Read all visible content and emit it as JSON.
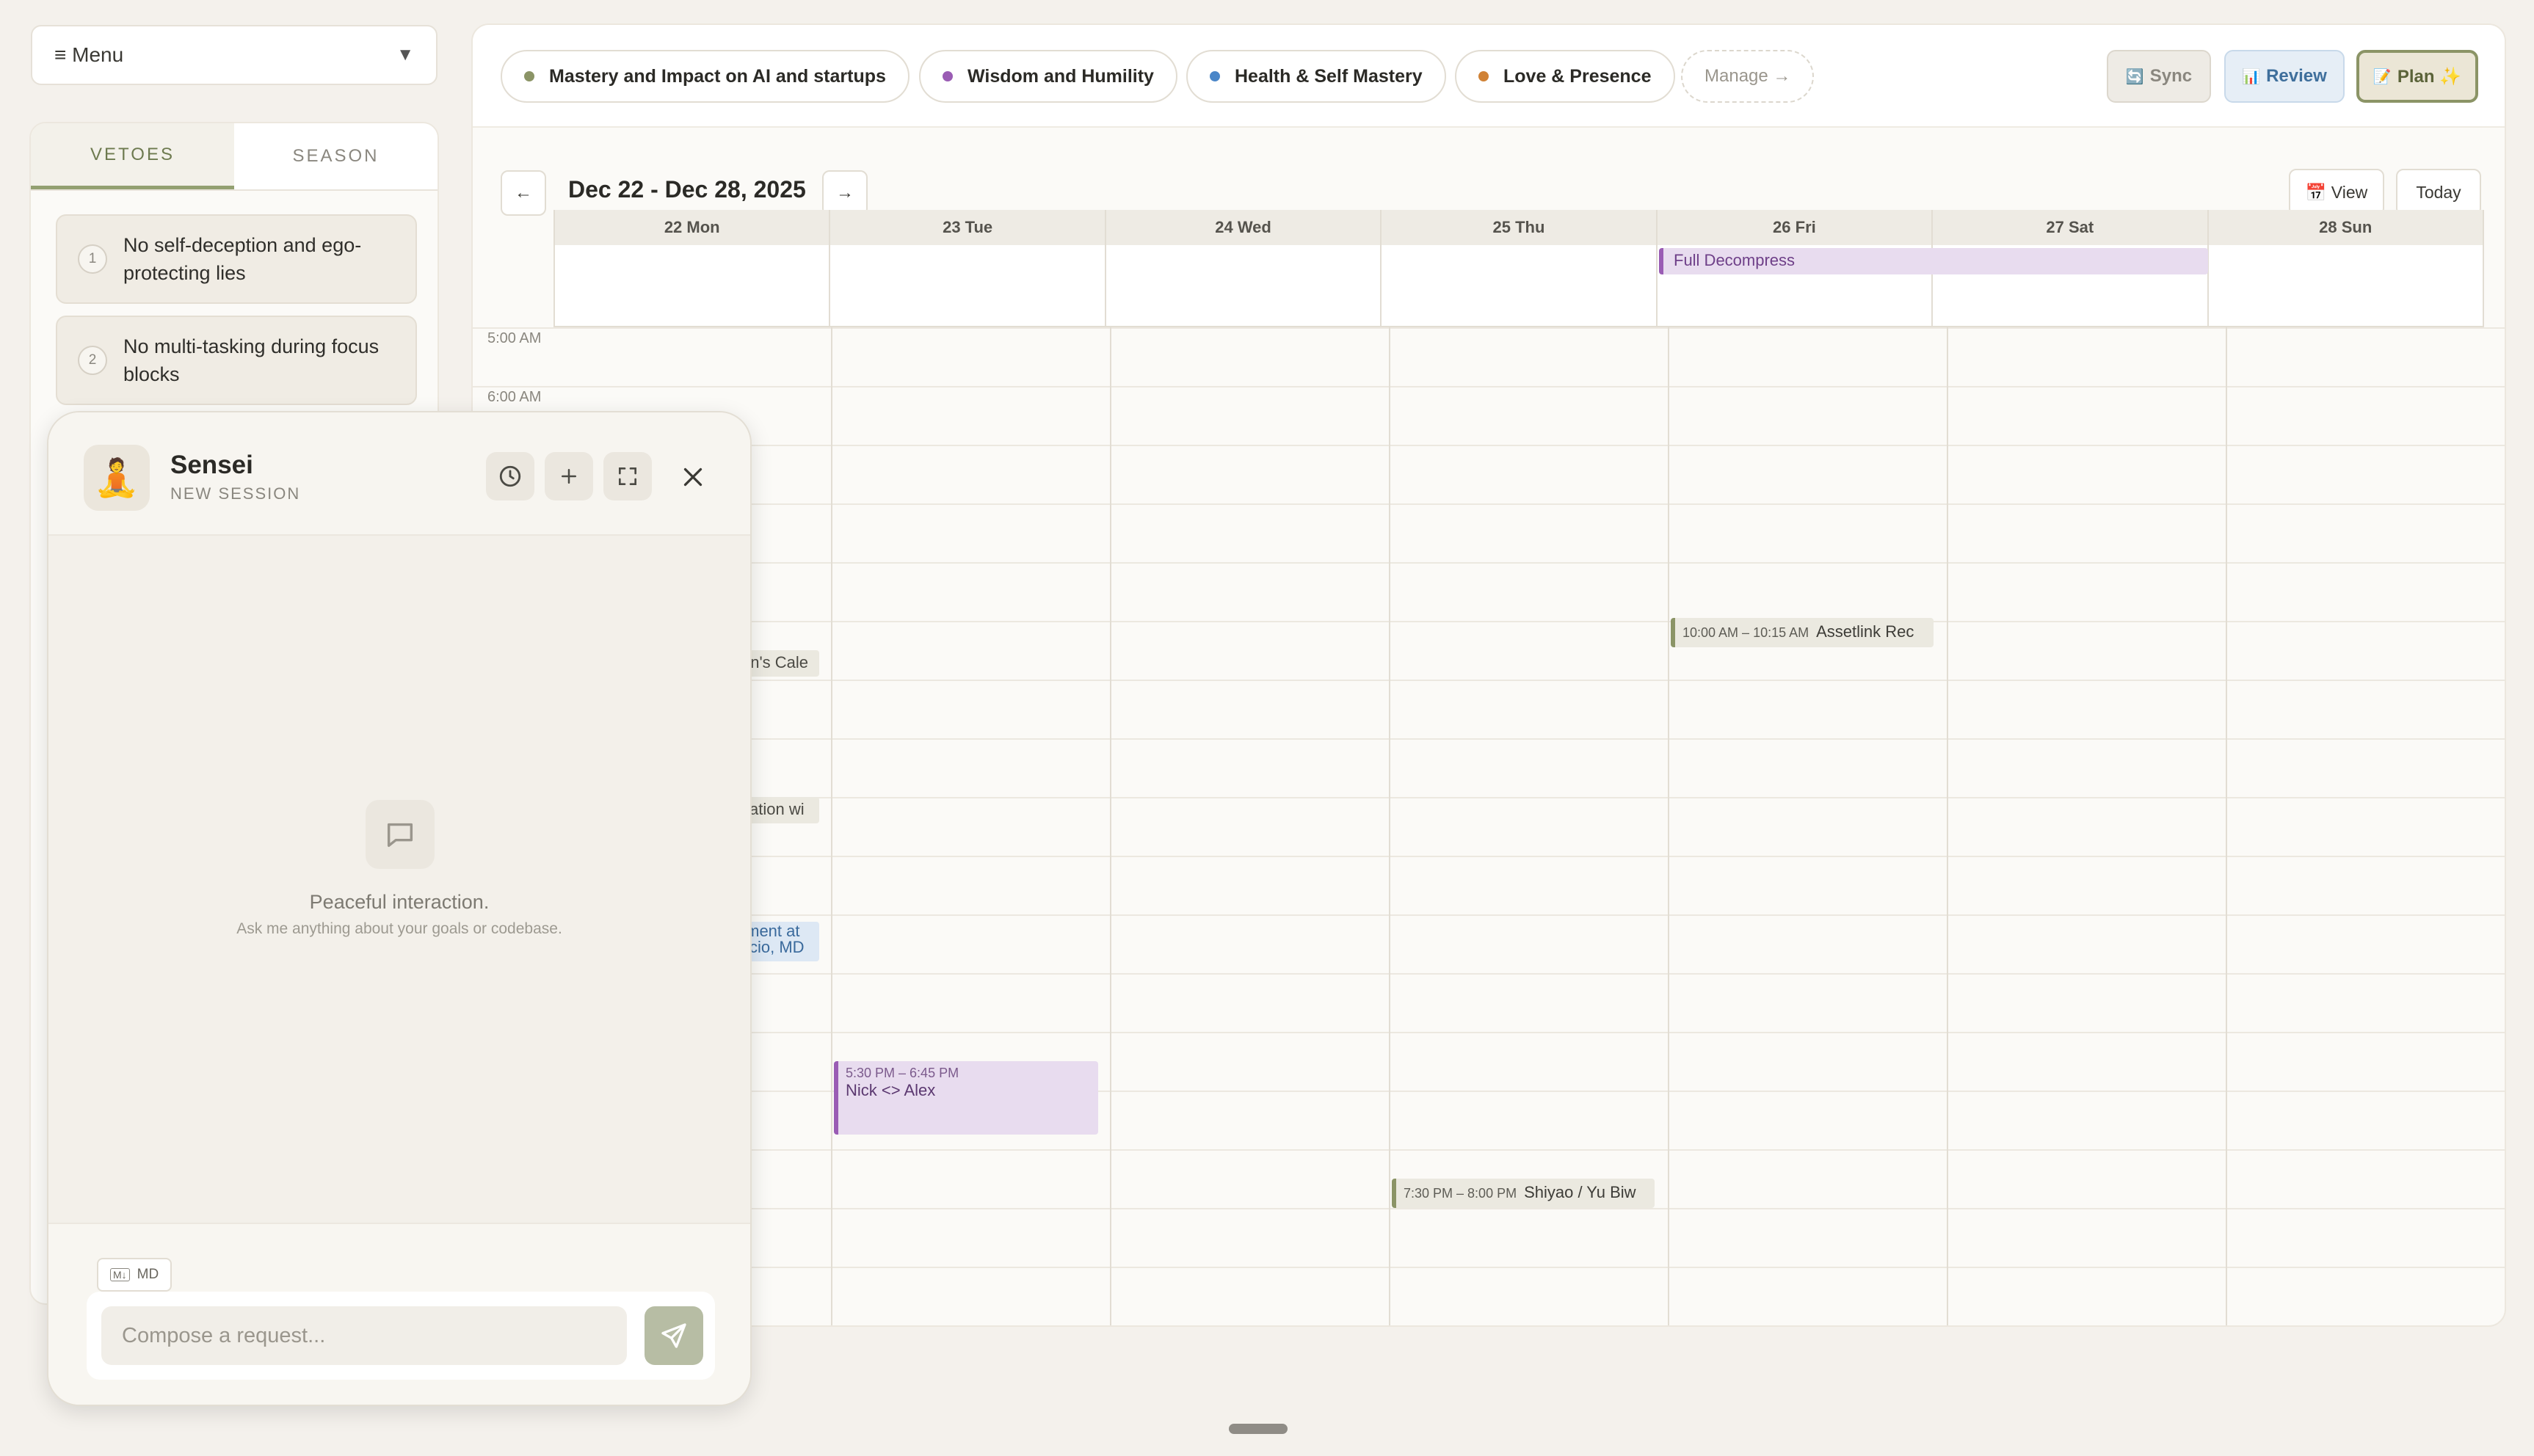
{
  "menu": {
    "label": "≡ Menu",
    "caret": "▼"
  },
  "left_panel": {
    "tabs": [
      {
        "label": "VETOES"
      },
      {
        "label": "SEASON"
      }
    ],
    "vetoes": [
      {
        "num": "1",
        "text": "No self-deception and ego-protecting lies"
      },
      {
        "num": "2",
        "text": "No multi-tasking during focus blocks"
      }
    ]
  },
  "goals": [
    {
      "label": "Mastery and Impact on AI and startups",
      "color": "#8b9466"
    },
    {
      "label": "Wisdom and Humility",
      "color": "#9a5cb4"
    },
    {
      "label": "Health & Self Mastery",
      "color": "#4a86c8"
    },
    {
      "label": "Love & Presence",
      "color": "#d08236"
    }
  ],
  "manage_label": "Manage →",
  "actions": {
    "sync": {
      "icon": "🔄",
      "label": "Sync"
    },
    "review": {
      "icon": "📊",
      "label": "Review"
    },
    "plan": {
      "icon": "📝",
      "label": "Plan ✨"
    }
  },
  "calendar": {
    "prev": "←",
    "next": "→",
    "range": "Dec 22 - Dec 28, 2025",
    "view_label": "📅 View",
    "today_label": "Today",
    "days": [
      "22 Mon",
      "23 Tue",
      "24 Wed",
      "25 Thu",
      "26 Fri",
      "27 Sat",
      "28 Sun"
    ],
    "time_labels": [
      "5:00 AM",
      "6:00 AM"
    ],
    "all_day_events": [
      {
        "title": "Full Decompress",
        "days": "26 Fri – 27 Sat"
      }
    ],
    "events": [
      {
        "day": "22 Mon",
        "title": "en's Cale",
        "time": ""
      },
      {
        "day": "22 Mon",
        "title": "sation wi",
        "time": ""
      },
      {
        "day": "22 Mon",
        "title": "tment at ccio, MD",
        "line1": "tment at",
        "line2": "ccio, MD",
        "time": ""
      },
      {
        "day": "23 Tue",
        "time": "5:30 PM – 6:45 PM",
        "title": "Nick <> Alex"
      },
      {
        "day": "25 Thu",
        "time": "7:30 PM – 8:00 PM",
        "title": "Shiyao / Yu Biw"
      },
      {
        "day": "26 Fri",
        "time": "10:00 AM – 10:15 AM",
        "title": "Assetlink Rec"
      }
    ]
  },
  "chat": {
    "avatar": "🧘",
    "name": "Sensei",
    "subtitle": "NEW SESSION",
    "empty_title": "Peaceful interaction.",
    "empty_subtitle": "Ask me anything about your goals or codebase.",
    "md_badge": "MD",
    "md_icon": "M↓",
    "placeholder": "Compose a request..."
  },
  "icons": {
    "history": "clock-icon",
    "new": "plus-icon",
    "expand": "expand-icon",
    "close": "close-icon",
    "send": "send-icon",
    "empty": "chat-bubble-icon"
  }
}
